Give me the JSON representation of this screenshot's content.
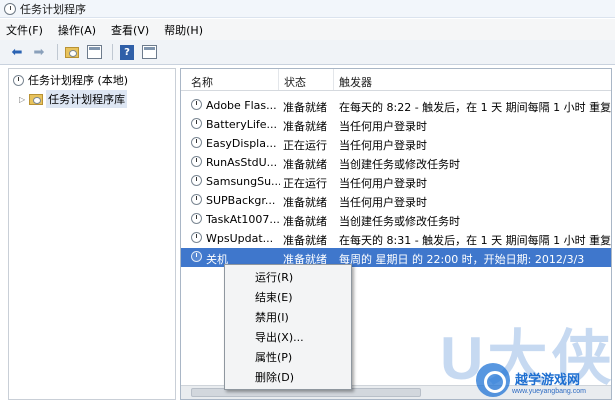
{
  "window": {
    "title": "任务计划程序"
  },
  "menubar": [
    {
      "label": "文件(F)"
    },
    {
      "label": "操作(A)"
    },
    {
      "label": "查看(V)"
    },
    {
      "label": "帮助(H)"
    }
  ],
  "toolbar": {
    "icons": [
      "back-arrow-icon",
      "forward-arrow-icon",
      "up-folder-icon",
      "show-hide-console-tree-icon",
      "help-icon",
      "show-hide-action-pane-icon"
    ]
  },
  "tree": {
    "root_label": "任务计划程序 (本地)",
    "child_label": "任务计划程序库"
  },
  "table": {
    "columns": [
      "名称",
      "状态",
      "触发器"
    ],
    "rows": [
      {
        "name": "Adobe Flas...",
        "status": "准备就绪",
        "trigger": "在每天的 8:22 - 触发后，在 1 天 期间每隔 1 小时 重复"
      },
      {
        "name": "BatteryLife...",
        "status": "准备就绪",
        "trigger": "当任何用户登录时"
      },
      {
        "name": "EasyDispla...",
        "status": "正在运行",
        "trigger": "当任何用户登录时"
      },
      {
        "name": "RunAsStdU...",
        "status": "准备就绪",
        "trigger": "当创建任务或修改任务时"
      },
      {
        "name": "SamsungSu...",
        "status": "正在运行",
        "trigger": "当任何用户登录时"
      },
      {
        "name": "SUPBackgr...",
        "status": "准备就绪",
        "trigger": "当任何用户登录时"
      },
      {
        "name": "TaskAt1007...",
        "status": "准备就绪",
        "trigger": "当创建任务或修改任务时"
      },
      {
        "name": "WpsUpdat...",
        "status": "准备就绪",
        "trigger": "在每天的 8:31 - 触发后，在 1 天 期间每隔 1 小时 重复"
      },
      {
        "name": "关机",
        "status": "准备就绪",
        "trigger": "每周的 星期日 的 22:00 时，开始日期: 2012/3/3"
      }
    ],
    "selected_index": 8
  },
  "context_menu": [
    {
      "label": "运行(R)"
    },
    {
      "label": "结束(E)"
    },
    {
      "label": "禁用(I)"
    },
    {
      "label": "导出(X)..."
    },
    {
      "label": "属性(P)"
    },
    {
      "label": "删除(D)"
    }
  ],
  "watermark": {
    "big_text": "U大侠",
    "site": "越学游戏网",
    "url": "www.yueyangbang.com"
  },
  "colors": {
    "selection": "#3f77cc",
    "toolbar_bg": "#f0f3f7",
    "watermark": "#1e6fd1"
  }
}
